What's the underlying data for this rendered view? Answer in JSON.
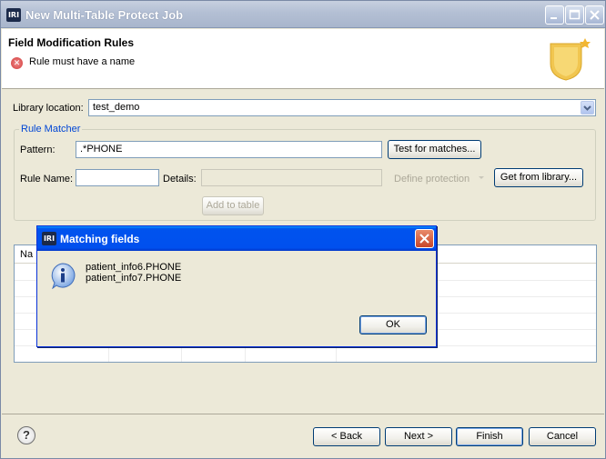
{
  "window": {
    "title": "New Multi-Table Protect Job",
    "logo_text": "IRI"
  },
  "header": {
    "title": "Field Modification Rules",
    "error_message": "Rule must have a name"
  },
  "form": {
    "library_location_label": "Library location:",
    "library_location_value": "test_demo",
    "rule_matcher_title": "Rule Matcher",
    "pattern_label": "Pattern:",
    "pattern_value": ".*PHONE",
    "test_button": "Test for matches...",
    "rule_name_label": "Rule Name:",
    "rule_name_value": "",
    "details_label": "Details:",
    "details_value": "",
    "define_protection_label": "Define protection",
    "get_library_button": "Get from library...",
    "add_to_table_button": "Add to table"
  },
  "table": {
    "first_header_partial": "Na"
  },
  "footer": {
    "help_icon": "?",
    "back_button": "< Back",
    "next_button": "Next >",
    "finish_button": "Finish",
    "cancel_button": "Cancel"
  },
  "dialog": {
    "title": "Matching fields",
    "logo_text": "IRI",
    "lines": [
      "patient_info6.PHONE",
      "patient_info7.PHONE"
    ],
    "ok_button": "OK"
  },
  "colors": {
    "window_bg": "#ece9d8",
    "dialog_title_blue": "#0053ee",
    "group_title_blue": "#0046d5",
    "error_red": "#d23a3a"
  }
}
